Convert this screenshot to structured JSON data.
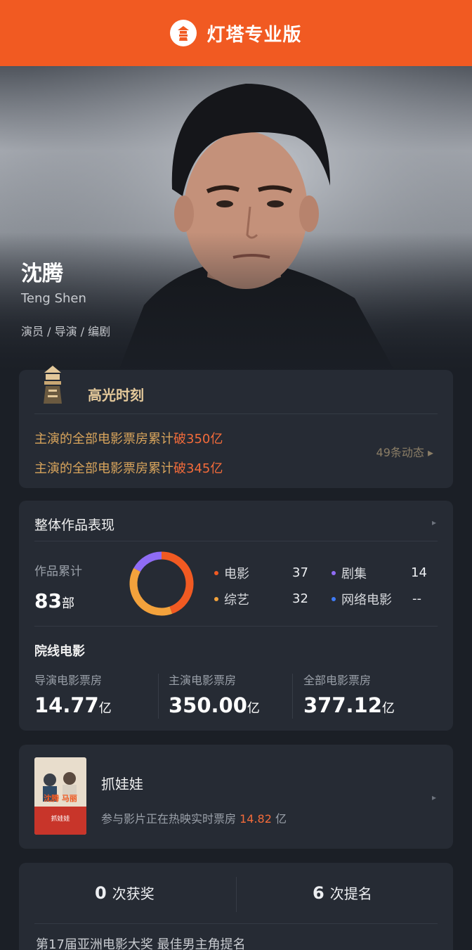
{
  "header": {
    "title": "灯塔专业版",
    "logo_icon": "lighthouse-logo-icon",
    "color": "#f15a22"
  },
  "profile": {
    "name_cn": "沈腾",
    "name_en": "Teng Shen",
    "roles": "演员 / 导演 / 编剧"
  },
  "highlights": {
    "title": "高光时刻",
    "items": [
      {
        "prefix": "主演的全部电影票房累计",
        "hot": "破350亿"
      },
      {
        "prefix": "主演的全部电影票房累计",
        "hot": "破345亿"
      }
    ],
    "more": "49条动态 ▸"
  },
  "works": {
    "title": "整体作品表现",
    "arrow": "▸",
    "total_label": "作品累计",
    "total_value": "83",
    "total_unit": "部",
    "legend": [
      {
        "label": "电影",
        "value": "37",
        "color": "#f15a22"
      },
      {
        "label": "剧集",
        "value": "14",
        "color": "#8f6cf5"
      },
      {
        "label": "综艺",
        "value": "32",
        "color": "#f3a23c"
      },
      {
        "label": "网络电影",
        "value": "--",
        "color": "#3f7bf6"
      }
    ],
    "cinema_title": "院线电影",
    "box_office": [
      {
        "label": "导演电影票房",
        "value": "14.77",
        "unit": "亿"
      },
      {
        "label": "主演电影票房",
        "value": "350.00",
        "unit": "亿"
      },
      {
        "label": "全部电影票房",
        "value": "377.12",
        "unit": "亿"
      }
    ]
  },
  "chart_data": {
    "type": "pie",
    "categories": [
      "电影",
      "剧集",
      "综艺",
      "网络电影"
    ],
    "values": [
      37,
      14,
      32,
      0
    ],
    "colors": [
      "#f15a22",
      "#8f6cf5",
      "#f3a23c",
      "#3f7bf6"
    ]
  },
  "film": {
    "title": "抓娃娃",
    "sub_prefix": "参与影片正在热映实时票房",
    "amount": "14.82",
    "unit": "亿",
    "arrow": "▸",
    "poster_text": "沈腾 马丽",
    "poster_tag": "抓娃娃"
  },
  "awards": {
    "wins_num": "0",
    "wins_label": "次获奖",
    "noms_num": "6",
    "noms_label": "次提名",
    "latest": "第17届亚洲电影大奖 最佳男主角提名"
  }
}
